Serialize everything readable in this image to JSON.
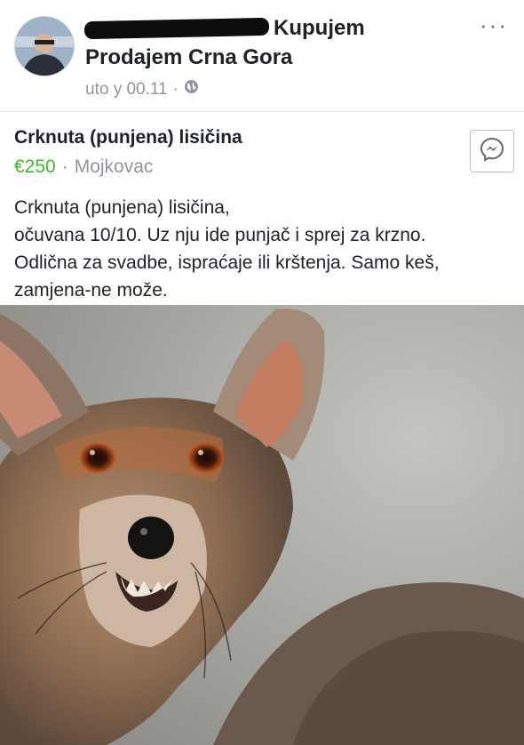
{
  "post": {
    "group_name_line1": "Kupujem",
    "group_name_line2": "Prodajem Crna Gora",
    "timestamp": "uto y 00.11",
    "separator": "·",
    "privacy_icon": "globe-icon",
    "more_icon": "more-options-icon",
    "more_label": "···"
  },
  "listing": {
    "title": "Crknuta (punjena) lisičina",
    "price": "€250",
    "separator": "·",
    "location": "Mojkovac",
    "message_icon": "messenger-icon",
    "description_lines": [
      "Crknuta (punjena) lisičina,",
      "očuvana 10/10. Uz nju ide punjač i sprej za krzno.",
      "Odlična za svadbe, ispraćaje ili krštenja. Samo keš,",
      "zamjena-ne može."
    ]
  },
  "colors": {
    "price": "#42b72a",
    "meta_gray": "#90949c",
    "text": "#1d2129"
  }
}
